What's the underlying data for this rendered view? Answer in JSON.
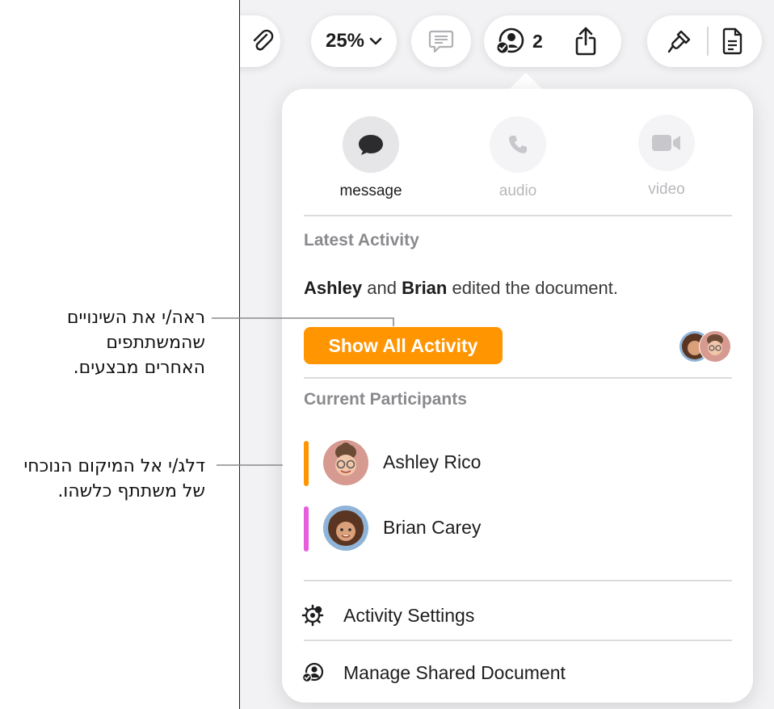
{
  "toolbar": {
    "zoom_label": "25%",
    "collaborator_count": "2"
  },
  "communication": {
    "message_label": "message",
    "audio_label": "audio",
    "video_label": "video"
  },
  "latest_activity": {
    "heading": "Latest Activity",
    "name_1": "Ashley",
    "and_text": "and",
    "name_2": "Brian",
    "action_text": "edited the document.",
    "button_label": "Show All Activity"
  },
  "participants": {
    "heading": "Current Participants",
    "items": [
      {
        "name": "Ashley Rico",
        "color": "#ff9500"
      },
      {
        "name": "Brian Carey",
        "color": "#e45ede"
      }
    ]
  },
  "menu": {
    "activity_settings": "Activity Settings",
    "manage_shared": "Manage Shared Document"
  },
  "callouts": {
    "top_line1": "ראה/י את השינויים",
    "top_line2": "שהמשתתפים",
    "top_line3": "האחרים מבצעים.",
    "bottom_line1": "דלג/י אל המיקום הנוכחי",
    "bottom_line2": "של משתתף כלשהו."
  },
  "colors": {
    "accent_orange": "#ff9500",
    "pink": "#e45ede"
  }
}
